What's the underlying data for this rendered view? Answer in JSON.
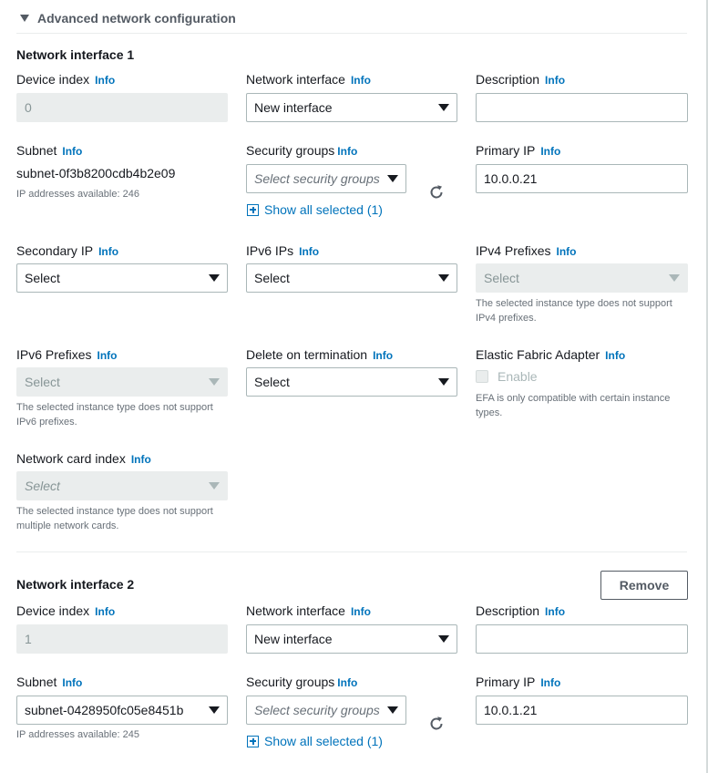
{
  "section": {
    "title": "Advanced network configuration"
  },
  "info_label": "Info",
  "interfaces": [
    {
      "title": "Network interface 1",
      "device_index": {
        "label": "Device index",
        "value": "0"
      },
      "network_interface": {
        "label": "Network interface",
        "value": "New interface"
      },
      "description": {
        "label": "Description",
        "value": ""
      },
      "subnet": {
        "label": "Subnet",
        "value": "subnet-0f3b8200cdb4b2e09",
        "hint": "IP addresses available: 246"
      },
      "security_groups": {
        "label": "Security groups",
        "placeholder": "Select security groups",
        "show_all": "Show all selected (1)"
      },
      "primary_ip": {
        "label": "Primary IP",
        "value": "10.0.0.21"
      },
      "secondary_ip": {
        "label": "Secondary IP",
        "value": "Select"
      },
      "ipv6_ips": {
        "label": "IPv6 IPs",
        "value": "Select"
      },
      "ipv4_prefixes": {
        "label": "IPv4 Prefixes",
        "value": "Select",
        "hint": "The selected instance type does not support IPv4 prefixes."
      },
      "ipv6_prefixes": {
        "label": "IPv6 Prefixes",
        "value": "Select",
        "hint": "The selected instance type does not support IPv6 prefixes."
      },
      "delete_on_termination": {
        "label": "Delete on termination",
        "value": "Select"
      },
      "efa": {
        "label": "Elastic Fabric Adapter",
        "checkbox_label": "Enable",
        "hint": "EFA is only compatible with certain instance types."
      },
      "network_card_index": {
        "label": "Network card index",
        "placeholder": "Select",
        "hint": "The selected instance type does not support multiple network cards."
      }
    },
    {
      "title": "Network interface 2",
      "remove_label": "Remove",
      "device_index": {
        "label": "Device index",
        "value": "1"
      },
      "network_interface": {
        "label": "Network interface",
        "value": "New interface"
      },
      "description": {
        "label": "Description",
        "value": ""
      },
      "subnet": {
        "label": "Subnet",
        "value": "subnet-0428950fc05e8451b",
        "hint": "IP addresses available: 245"
      },
      "security_groups": {
        "label": "Security groups",
        "placeholder": "Select security groups",
        "show_all": "Show all selected (1)"
      },
      "primary_ip": {
        "label": "Primary IP",
        "value": "10.0.1.21"
      }
    }
  ]
}
